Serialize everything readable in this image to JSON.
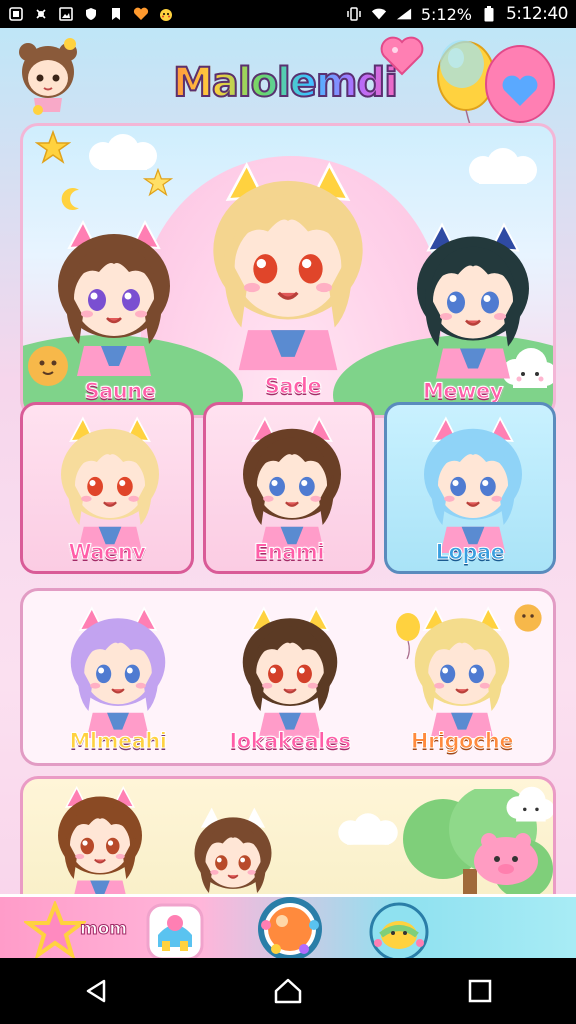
{
  "status_bar": {
    "battery_percent": "5:12%",
    "time": "5:12:40",
    "left_icons": [
      "sim-icon",
      "bug-icon",
      "image-icon",
      "shield-icon",
      "bookmark-icon",
      "heart-icon",
      "pikachu-icon"
    ],
    "right_icons": [
      "vibrate-icon",
      "wifi-icon",
      "signal-icon",
      "battery-icon"
    ]
  },
  "header": {
    "title": "Malolemdi"
  },
  "hero": {
    "characters": [
      {
        "name": "Saune",
        "hair": "#7a4a2e",
        "ear": "#ff7fb3",
        "eyes": "#7a4fd1"
      },
      {
        "name": "Sade",
        "hair": "#f4d58f",
        "ear": "#ffd23f",
        "eyes": "#e0452a"
      },
      {
        "name": "Mewey",
        "hair": "#23393c",
        "ear": "#2f4aa3",
        "eyes": "#4f7bd1"
      }
    ]
  },
  "grid_row1": [
    {
      "name": "Waenv",
      "hair": "#f7dc9c",
      "accent": "#ffd23f",
      "eyes": "#e0452a",
      "style": "pink"
    },
    {
      "name": "Enami",
      "hair": "#6a3f26",
      "accent": "#ff7fb3",
      "eyes": "#4f7bd1",
      "style": "pink"
    },
    {
      "name": "Lopae",
      "hair": "#8fd3f7",
      "accent": "#ff7fb3",
      "eyes": "#4f7bd1",
      "style": "blue"
    }
  ],
  "grid_row2": [
    {
      "name": "Mlmeahi",
      "hair": "#c2a3f0",
      "accent": "#ff7fb3",
      "eyes": "#4f7bd1"
    },
    {
      "name": "Iokakeales",
      "hair": "#5b3a24",
      "accent": "#ffd23f",
      "eyes": "#d3402a"
    },
    {
      "name": "Hrigoche",
      "hair": "#f4dc8c",
      "accent": "#ffd23f",
      "eyes": "#4f7bd1"
    }
  ],
  "grid_row3": [
    {
      "hair": "#8a4a24",
      "accent": "#ff7fb3",
      "eyes": "#b84a2a"
    },
    {
      "hair": "#7a4a2e",
      "accent": "#ffffff",
      "eyes": "#b84a2a"
    }
  ],
  "toolbar": {
    "label": "mom",
    "buttons": [
      "star-button",
      "toy-button",
      "center-orb-button",
      "gift-button"
    ]
  },
  "nav": [
    "back-button",
    "home-button",
    "recents-button"
  ],
  "colors": {
    "accent_pink": "#ff5ea8",
    "card_border": "#d95b97",
    "sky": "#bfe6f7"
  }
}
